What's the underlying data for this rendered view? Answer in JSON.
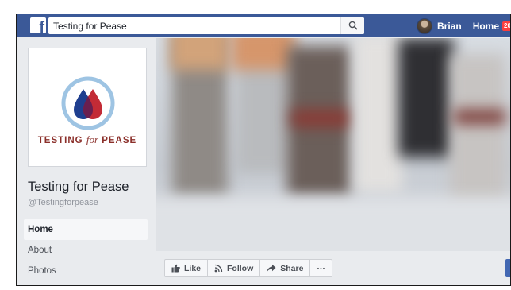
{
  "topbar": {
    "logo": "f",
    "search_value": "Testing for Pease",
    "user_name": "Brian",
    "home_label": "Home",
    "home_badge": "20+"
  },
  "profile": {
    "logo_text_a": "TESTING",
    "logo_text_for": "for",
    "logo_text_b": "PEASE",
    "page_title": "Testing for Pease",
    "handle": "@Testingforpease"
  },
  "side_nav": {
    "items": [
      {
        "label": "Home"
      },
      {
        "label": "About"
      },
      {
        "label": "Photos"
      }
    ]
  },
  "actions": {
    "like": "Like",
    "follow": "Follow",
    "share": "Share",
    "more": "···"
  },
  "colors": {
    "facebook_blue": "#3b5998",
    "drop_blue": "#1f3f8f",
    "drop_red": "#c0202b",
    "logo_ring": "#9ec4e3"
  }
}
